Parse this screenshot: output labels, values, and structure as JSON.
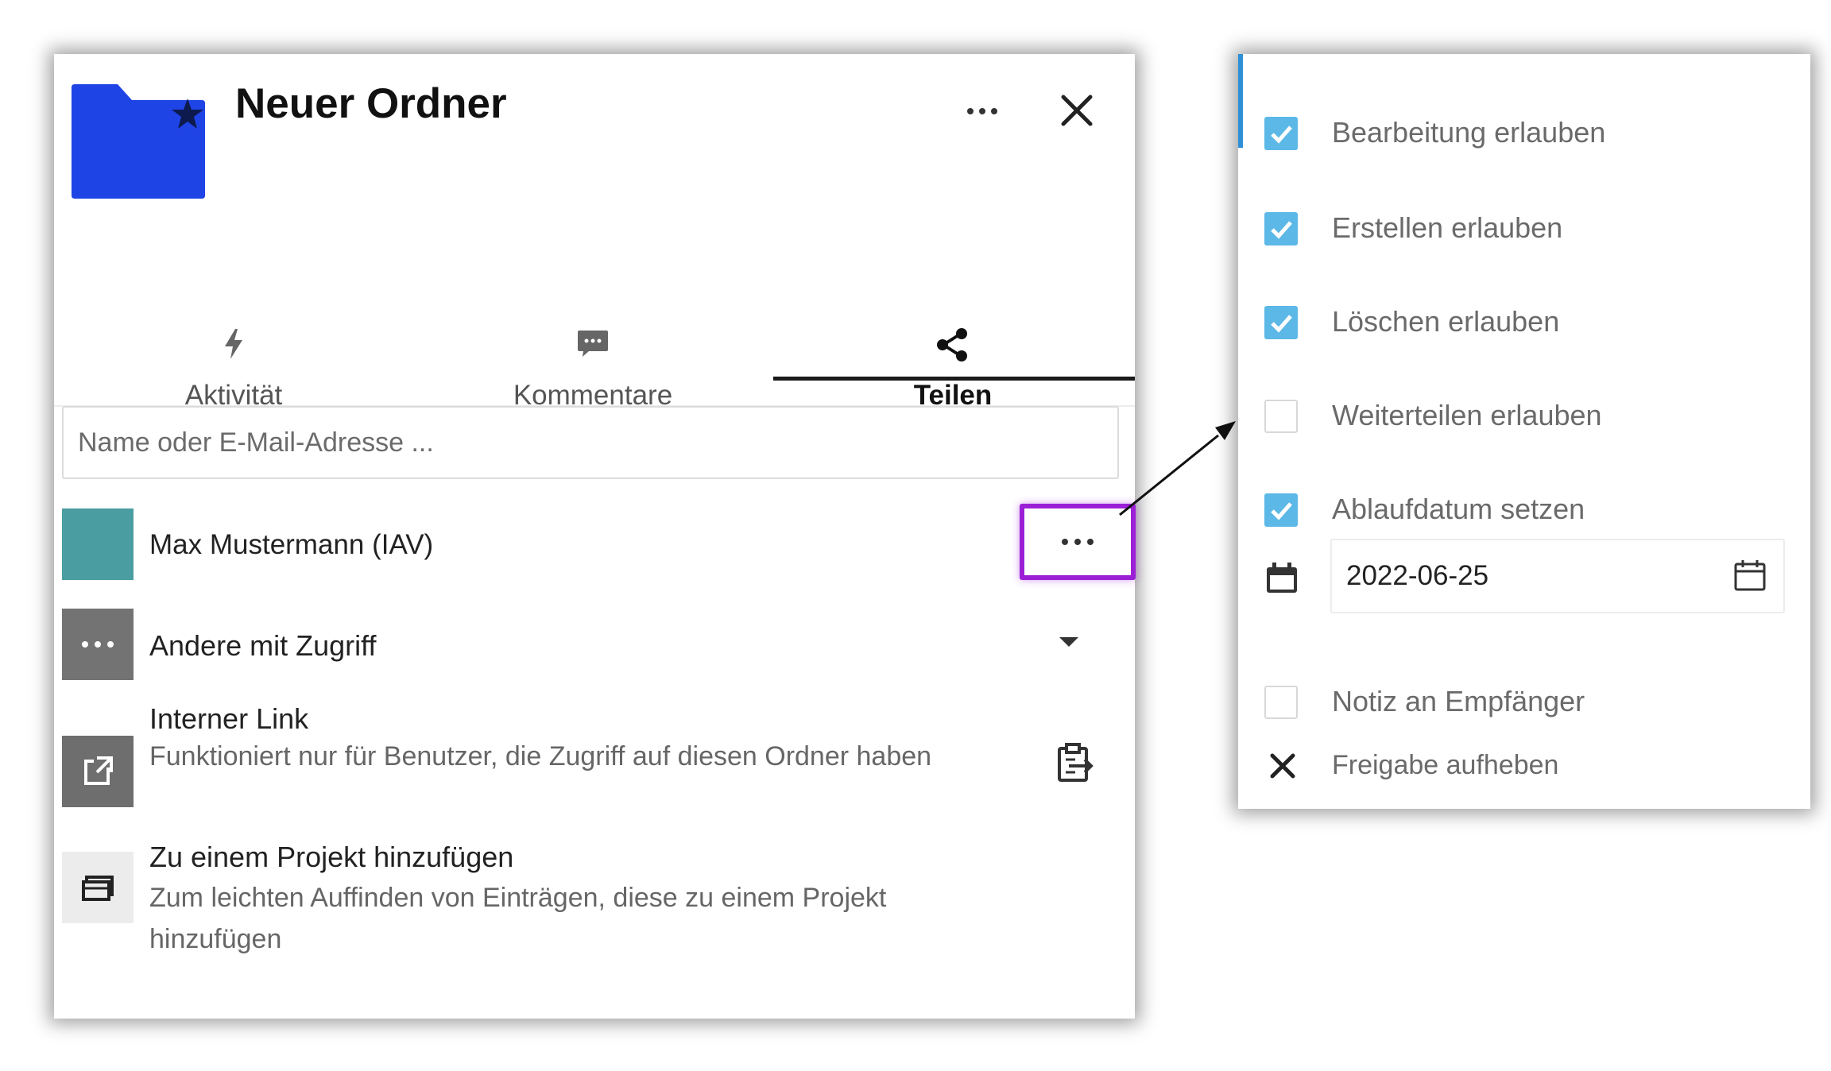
{
  "header": {
    "title": "Neuer Ordner",
    "folder_color": "#1f44e6"
  },
  "tabs": [
    {
      "label": "Aktivität",
      "icon": "lightning-icon",
      "active": false
    },
    {
      "label": "Kommentare",
      "icon": "comment-icon",
      "active": false
    },
    {
      "label": "Teilen",
      "icon": "share-icon",
      "active": true
    }
  ],
  "search": {
    "placeholder": "Name oder E-Mail-Adresse ..."
  },
  "share": {
    "user_name": "Max Mustermann (IAV)",
    "others_label": "Andere mit Zugriff",
    "internal_link_title": "Interner Link",
    "internal_link_desc": "Funktioniert nur für Benutzer, die Zugriff auf diesen Ordner haben",
    "project_title": "Zu einem Projekt hinzufügen",
    "project_desc": "Zum leichten Auffinden von Einträgen, diese zu einem Projekt hinzufügen"
  },
  "menu": {
    "items": [
      {
        "label": "Bearbeitung erlauben",
        "checked": true
      },
      {
        "label": "Erstellen erlauben",
        "checked": true
      },
      {
        "label": "Löschen erlauben",
        "checked": true
      },
      {
        "label": "Weiterteilen erlauben",
        "checked": false
      },
      {
        "label": "Ablaufdatum setzen",
        "checked": true
      }
    ],
    "expiry_date": "2022-06-25",
    "note_label": "Notiz an Empfänger",
    "note_checked": false,
    "unshare_label": "Freigabe aufheben"
  },
  "colors": {
    "highlight": "#9b1fd6",
    "checkbox": "#5cb8e6",
    "accent": "#2f8fd6",
    "user_avatar": "#4a9da0"
  }
}
